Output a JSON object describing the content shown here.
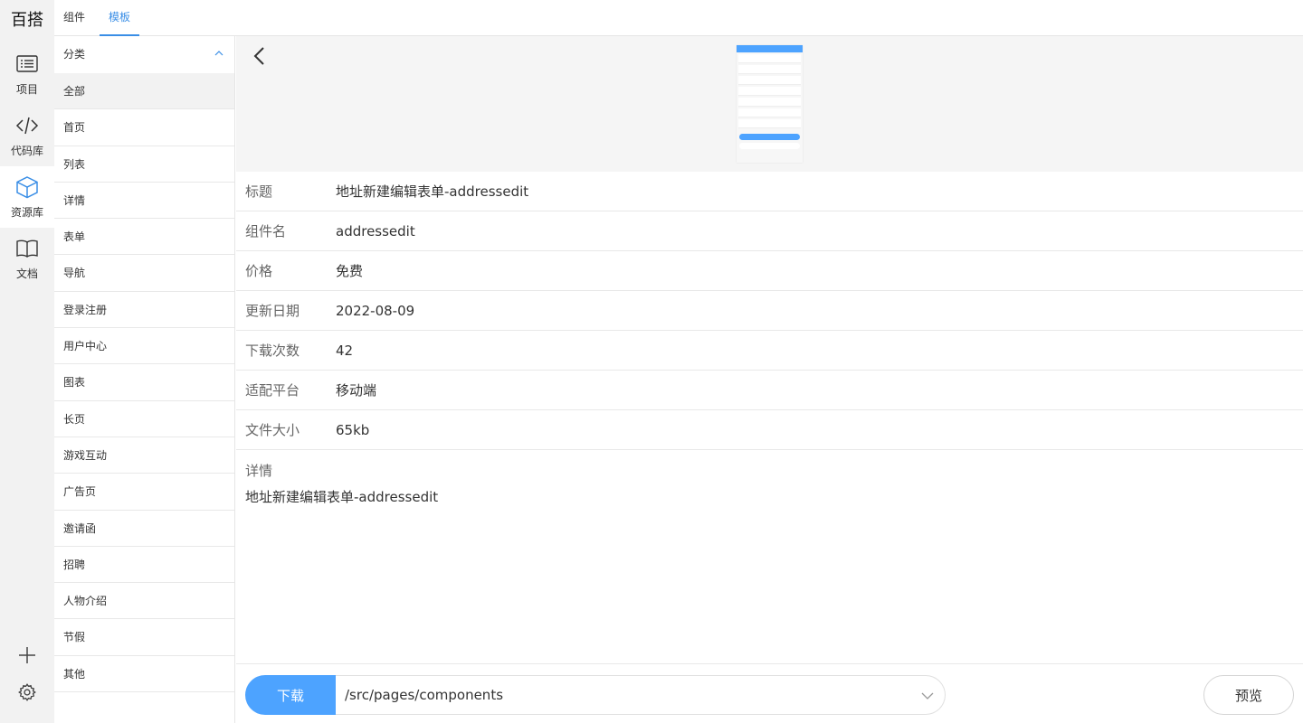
{
  "brand": "百搭",
  "rail": {
    "items": [
      {
        "label": "项目",
        "icon": "list-icon"
      },
      {
        "label": "代码库",
        "icon": "code-icon"
      },
      {
        "label": "资源库",
        "icon": "cube-icon"
      },
      {
        "label": "文档",
        "icon": "book-icon"
      }
    ],
    "active_index": 2,
    "bottom_icons": [
      "plus-icon",
      "gear-icon"
    ]
  },
  "tabs": [
    {
      "label": "组件"
    },
    {
      "label": "模板"
    }
  ],
  "active_tab": 1,
  "categories": {
    "title": "分类",
    "items": [
      "全部",
      "首页",
      "列表",
      "详情",
      "表单",
      "导航",
      "登录注册",
      "用户中心",
      "图表",
      "长页",
      "游戏互动",
      "广告页",
      "邀请函",
      "招聘",
      "人物介绍",
      "节假",
      "其他"
    ],
    "active_index": 0
  },
  "info": [
    {
      "key": "标题",
      "value": "地址新建编辑表单-addressedit"
    },
    {
      "key": "组件名",
      "value": "addressedit"
    },
    {
      "key": "价格",
      "value": "免费"
    },
    {
      "key": "更新日期",
      "value": "2022-08-09"
    },
    {
      "key": "下载次数",
      "value": "42"
    },
    {
      "key": "适配平台",
      "value": "移动端"
    },
    {
      "key": "文件大小",
      "value": "65kb"
    }
  ],
  "detail": {
    "key": "详情",
    "value": "地址新建编辑表单-addressedit"
  },
  "footer": {
    "download_label": "下载",
    "path_value": "/src/pages/components",
    "preview_label": "预览"
  },
  "colors": {
    "accent": "#4da3ff",
    "tab_active": "#3a8ee6"
  }
}
